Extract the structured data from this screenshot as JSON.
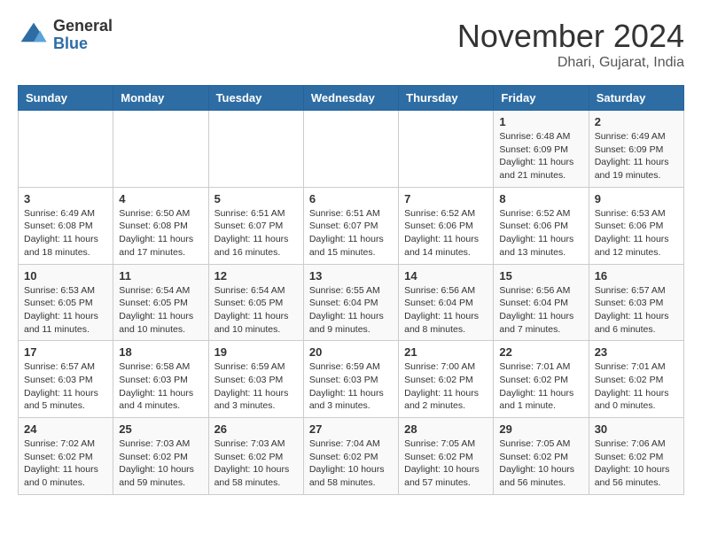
{
  "header": {
    "logo_line1": "General",
    "logo_line2": "Blue",
    "month_title": "November 2024",
    "subtitle": "Dhari, Gujarat, India"
  },
  "weekdays": [
    "Sunday",
    "Monday",
    "Tuesday",
    "Wednesday",
    "Thursday",
    "Friday",
    "Saturday"
  ],
  "weeks": [
    [
      {
        "day": "",
        "info": ""
      },
      {
        "day": "",
        "info": ""
      },
      {
        "day": "",
        "info": ""
      },
      {
        "day": "",
        "info": ""
      },
      {
        "day": "",
        "info": ""
      },
      {
        "day": "1",
        "info": "Sunrise: 6:48 AM\nSunset: 6:09 PM\nDaylight: 11 hours\nand 21 minutes."
      },
      {
        "day": "2",
        "info": "Sunrise: 6:49 AM\nSunset: 6:09 PM\nDaylight: 11 hours\nand 19 minutes."
      }
    ],
    [
      {
        "day": "3",
        "info": "Sunrise: 6:49 AM\nSunset: 6:08 PM\nDaylight: 11 hours\nand 18 minutes."
      },
      {
        "day": "4",
        "info": "Sunrise: 6:50 AM\nSunset: 6:08 PM\nDaylight: 11 hours\nand 17 minutes."
      },
      {
        "day": "5",
        "info": "Sunrise: 6:51 AM\nSunset: 6:07 PM\nDaylight: 11 hours\nand 16 minutes."
      },
      {
        "day": "6",
        "info": "Sunrise: 6:51 AM\nSunset: 6:07 PM\nDaylight: 11 hours\nand 15 minutes."
      },
      {
        "day": "7",
        "info": "Sunrise: 6:52 AM\nSunset: 6:06 PM\nDaylight: 11 hours\nand 14 minutes."
      },
      {
        "day": "8",
        "info": "Sunrise: 6:52 AM\nSunset: 6:06 PM\nDaylight: 11 hours\nand 13 minutes."
      },
      {
        "day": "9",
        "info": "Sunrise: 6:53 AM\nSunset: 6:06 PM\nDaylight: 11 hours\nand 12 minutes."
      }
    ],
    [
      {
        "day": "10",
        "info": "Sunrise: 6:53 AM\nSunset: 6:05 PM\nDaylight: 11 hours\nand 11 minutes."
      },
      {
        "day": "11",
        "info": "Sunrise: 6:54 AM\nSunset: 6:05 PM\nDaylight: 11 hours\nand 10 minutes."
      },
      {
        "day": "12",
        "info": "Sunrise: 6:54 AM\nSunset: 6:05 PM\nDaylight: 11 hours\nand 10 minutes."
      },
      {
        "day": "13",
        "info": "Sunrise: 6:55 AM\nSunset: 6:04 PM\nDaylight: 11 hours\nand 9 minutes."
      },
      {
        "day": "14",
        "info": "Sunrise: 6:56 AM\nSunset: 6:04 PM\nDaylight: 11 hours\nand 8 minutes."
      },
      {
        "day": "15",
        "info": "Sunrise: 6:56 AM\nSunset: 6:04 PM\nDaylight: 11 hours\nand 7 minutes."
      },
      {
        "day": "16",
        "info": "Sunrise: 6:57 AM\nSunset: 6:03 PM\nDaylight: 11 hours\nand 6 minutes."
      }
    ],
    [
      {
        "day": "17",
        "info": "Sunrise: 6:57 AM\nSunset: 6:03 PM\nDaylight: 11 hours\nand 5 minutes."
      },
      {
        "day": "18",
        "info": "Sunrise: 6:58 AM\nSunset: 6:03 PM\nDaylight: 11 hours\nand 4 minutes."
      },
      {
        "day": "19",
        "info": "Sunrise: 6:59 AM\nSunset: 6:03 PM\nDaylight: 11 hours\nand 3 minutes."
      },
      {
        "day": "20",
        "info": "Sunrise: 6:59 AM\nSunset: 6:03 PM\nDaylight: 11 hours\nand 3 minutes."
      },
      {
        "day": "21",
        "info": "Sunrise: 7:00 AM\nSunset: 6:02 PM\nDaylight: 11 hours\nand 2 minutes."
      },
      {
        "day": "22",
        "info": "Sunrise: 7:01 AM\nSunset: 6:02 PM\nDaylight: 11 hours\nand 1 minute."
      },
      {
        "day": "23",
        "info": "Sunrise: 7:01 AM\nSunset: 6:02 PM\nDaylight: 11 hours\nand 0 minutes."
      }
    ],
    [
      {
        "day": "24",
        "info": "Sunrise: 7:02 AM\nSunset: 6:02 PM\nDaylight: 11 hours\nand 0 minutes."
      },
      {
        "day": "25",
        "info": "Sunrise: 7:03 AM\nSunset: 6:02 PM\nDaylight: 10 hours\nand 59 minutes."
      },
      {
        "day": "26",
        "info": "Sunrise: 7:03 AM\nSunset: 6:02 PM\nDaylight: 10 hours\nand 58 minutes."
      },
      {
        "day": "27",
        "info": "Sunrise: 7:04 AM\nSunset: 6:02 PM\nDaylight: 10 hours\nand 58 minutes."
      },
      {
        "day": "28",
        "info": "Sunrise: 7:05 AM\nSunset: 6:02 PM\nDaylight: 10 hours\nand 57 minutes."
      },
      {
        "day": "29",
        "info": "Sunrise: 7:05 AM\nSunset: 6:02 PM\nDaylight: 10 hours\nand 56 minutes."
      },
      {
        "day": "30",
        "info": "Sunrise: 7:06 AM\nSunset: 6:02 PM\nDaylight: 10 hours\nand 56 minutes."
      }
    ]
  ]
}
